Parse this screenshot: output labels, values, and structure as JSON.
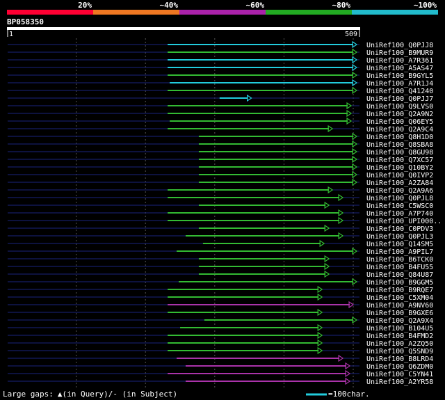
{
  "legend": {
    "segments": [
      {
        "label": "20%",
        "color": "#ff0033"
      },
      {
        "label": "~40%",
        "color": "#ee7722"
      },
      {
        "label": "~60%",
        "color": "#aa22aa"
      },
      {
        "label": "~80%",
        "color": "#22aa22"
      },
      {
        "label": "~100%",
        "color": "#22bbcc"
      }
    ]
  },
  "query": {
    "id": "BP058350",
    "start": "1",
    "end": "509",
    "length": 509
  },
  "colors": {
    "cyan": "#22ccdd",
    "green": "#33bb33",
    "purple": "#aa33aa",
    "navy": "#1a237e",
    "grid": "#555555"
  },
  "hits": [
    {
      "name": "UniRef100_Q0PJJ8",
      "start": 232,
      "end": 505,
      "color": "cyan"
    },
    {
      "name": "UniRef100_B9MUR9",
      "start": 232,
      "end": 505,
      "color": "green"
    },
    {
      "name": "UniRef100_A7R361",
      "start": 232,
      "end": 505,
      "color": "cyan"
    },
    {
      "name": "UniRef100_A5AS47",
      "start": 232,
      "end": 505,
      "color": "cyan"
    },
    {
      "name": "UniRef100_B9GYL5",
      "start": 232,
      "end": 505,
      "color": "green"
    },
    {
      "name": "UniRef100_A7R1J4",
      "start": 235,
      "end": 505,
      "color": "cyan"
    },
    {
      "name": "UniRef100_Q41240",
      "start": 232,
      "end": 505,
      "color": "green"
    },
    {
      "name": "UniRef100_Q0PJJ7",
      "start": 307,
      "end": 353,
      "color": "cyan"
    },
    {
      "name": "UniRef100_Q9LVS0",
      "start": 232,
      "end": 497,
      "color": "green"
    },
    {
      "name": "UniRef100_Q2A9N2",
      "start": 232,
      "end": 497,
      "color": "green"
    },
    {
      "name": "UniRef100_Q06EY5",
      "start": 235,
      "end": 497,
      "color": "green"
    },
    {
      "name": "UniRef100_Q2A9C4",
      "start": 232,
      "end": 470,
      "color": "green"
    },
    {
      "name": "UniRef100_Q8H1D0",
      "start": 277,
      "end": 505,
      "color": "green"
    },
    {
      "name": "UniRef100_Q8SBA8",
      "start": 277,
      "end": 505,
      "color": "green"
    },
    {
      "name": "UniRef100_Q8GU98",
      "start": 277,
      "end": 505,
      "color": "green"
    },
    {
      "name": "UniRef100_Q7XC57",
      "start": 277,
      "end": 505,
      "color": "green"
    },
    {
      "name": "UniRef100_Q10BY2",
      "start": 277,
      "end": 505,
      "color": "green"
    },
    {
      "name": "UniRef100_Q0IVP2",
      "start": 277,
      "end": 505,
      "color": "green"
    },
    {
      "name": "UniRef100_A2ZA84",
      "start": 277,
      "end": 505,
      "color": "green"
    },
    {
      "name": "UniRef100_Q2A9A6",
      "start": 232,
      "end": 470,
      "color": "green"
    },
    {
      "name": "UniRef100_Q0PJL8",
      "start": 232,
      "end": 485,
      "color": "green"
    },
    {
      "name": "UniRef100_C5WSC0",
      "start": 277,
      "end": 465,
      "color": "green"
    },
    {
      "name": "UniRef100_A7P740",
      "start": 232,
      "end": 485,
      "color": "green"
    },
    {
      "name": "UniRef100_UPI000..",
      "start": 232,
      "end": 485,
      "color": "green"
    },
    {
      "name": "UniRef100_C0PDV3",
      "start": 277,
      "end": 465,
      "color": "green"
    },
    {
      "name": "UniRef100_Q0PJL3",
      "start": 258,
      "end": 485,
      "color": "green"
    },
    {
      "name": "UniRef100_Q14SM5",
      "start": 283,
      "end": 458,
      "color": "green"
    },
    {
      "name": "UniRef100_A9PIL7",
      "start": 245,
      "end": 505,
      "color": "green"
    },
    {
      "name": "UniRef100_B6TCK0",
      "start": 277,
      "end": 465,
      "color": "green"
    },
    {
      "name": "UniRef100_B4FU55",
      "start": 277,
      "end": 465,
      "color": "green"
    },
    {
      "name": "UniRef100_Q84U87",
      "start": 277,
      "end": 465,
      "color": "green"
    },
    {
      "name": "UniRef100_B9GGM5",
      "start": 248,
      "end": 505,
      "color": "green"
    },
    {
      "name": "UniRef100_B9RQE7",
      "start": 232,
      "end": 455,
      "color": "green"
    },
    {
      "name": "UniRef100_C5XM04",
      "start": 232,
      "end": 455,
      "color": "green"
    },
    {
      "name": "UniRef100_A9NV60",
      "start": 232,
      "end": 500,
      "color": "purple"
    },
    {
      "name": "UniRef100_B9GXE6",
      "start": 232,
      "end": 455,
      "color": "green"
    },
    {
      "name": "UniRef100_Q2A9X4",
      "start": 285,
      "end": 505,
      "color": "green"
    },
    {
      "name": "UniRef100_B104U5",
      "start": 250,
      "end": 455,
      "color": "green"
    },
    {
      "name": "UniRef100_B4FMD2",
      "start": 232,
      "end": 455,
      "color": "green"
    },
    {
      "name": "UniRef100_A2ZQ50",
      "start": 232,
      "end": 455,
      "color": "green"
    },
    {
      "name": "UniRef100_Q5SND9",
      "start": 232,
      "end": 455,
      "color": "green"
    },
    {
      "name": "UniRef100_B8LRD4",
      "start": 245,
      "end": 485,
      "color": "purple"
    },
    {
      "name": "UniRef100_Q6ZDM0",
      "start": 258,
      "end": 495,
      "color": "purple"
    },
    {
      "name": "UniRef100_C5YN41",
      "start": 232,
      "end": 495,
      "color": "purple"
    },
    {
      "name": "UniRef100_A2YR58",
      "start": 258,
      "end": 495,
      "color": "purple"
    }
  ],
  "footer": {
    "gaps_label": "Large gaps:",
    "query_marker": "▲",
    "query_text": "(in Query)/",
    "subject_marker": "-",
    "subject_text": " (in Subject)",
    "scale_text": "=100char.",
    "scale_color": "#22ccdd"
  }
}
